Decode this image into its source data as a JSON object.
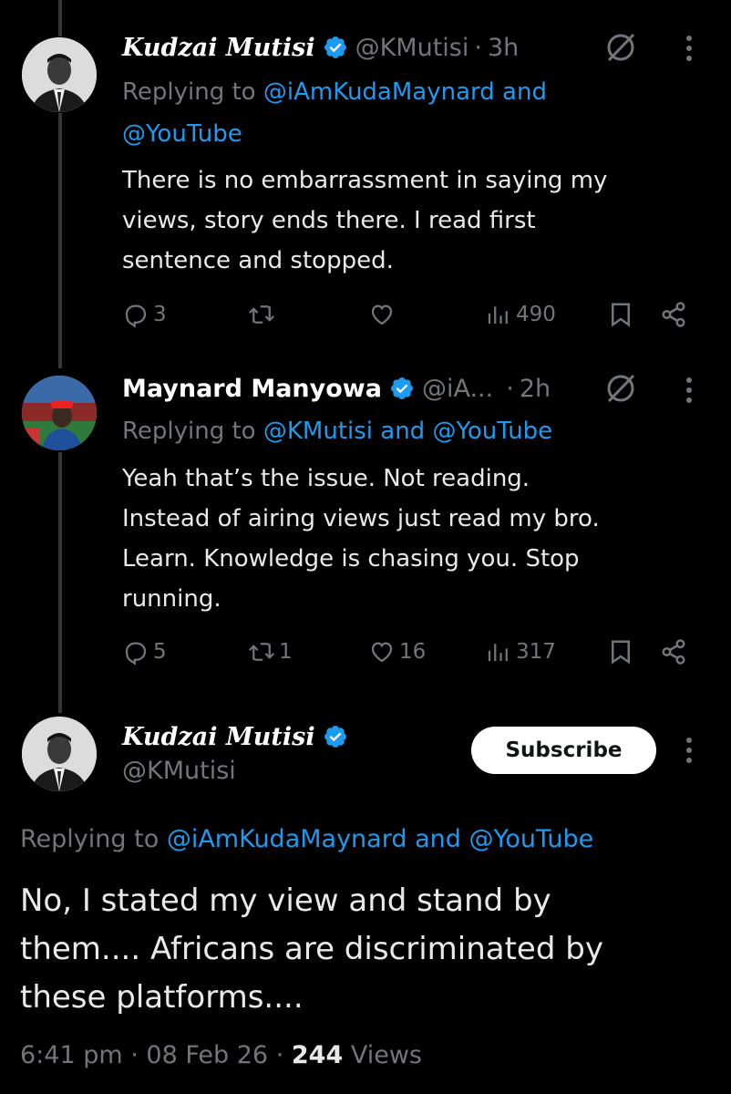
{
  "tweet1": {
    "name": "Kudzai Mutisi",
    "handle": "@KMutisi",
    "time": "3h",
    "replying_prefix": "Replying to",
    "replying_mentions": "@iAmKudaMaynard and",
    "replying_mentions2": "@YouTube",
    "text_lines": [
      "There is no embarrassment in saying my",
      "views, story ends there. I read first",
      "sentence and stopped."
    ],
    "replies": "3",
    "retweets": "",
    "likes": "",
    "views": "490"
  },
  "tweet2": {
    "name": "Maynard Manyowa",
    "handle": "@iA...",
    "time": "2h",
    "replying_prefix": "Replying to",
    "replying_mentions": "@KMutisi and @YouTube",
    "text_lines": [
      "Yeah that’s the issue. Not reading.",
      "Instead of airing views just read my bro.",
      "Learn. Knowledge is chasing you. Stop",
      "running."
    ],
    "replies": "5",
    "retweets": "1",
    "likes": "16",
    "views": "317"
  },
  "main": {
    "name": "Kudzai Mutisi",
    "handle": "@KMutisi",
    "subscribe_label": "Subscribe",
    "replying_prefix": "Replying to",
    "replying_mentions": "@iAmKudaMaynard and @YouTube",
    "text_lines": [
      "No, I stated my view and stand by",
      "them.... Africans are discriminated by",
      "these platforms...."
    ],
    "time": "6:41 pm",
    "date": "08 Feb 26",
    "views_count": "244",
    "views_label": "Views"
  },
  "colors": {
    "background": "#000000",
    "text": "#e7e9ea",
    "muted": "#71767b",
    "accent": "#1d9bf0"
  },
  "icons": [
    "verified-badge-icon",
    "grok-icon",
    "more-icon",
    "reply-icon",
    "retweet-icon",
    "like-icon",
    "views-icon",
    "bookmark-icon",
    "share-icon"
  ]
}
